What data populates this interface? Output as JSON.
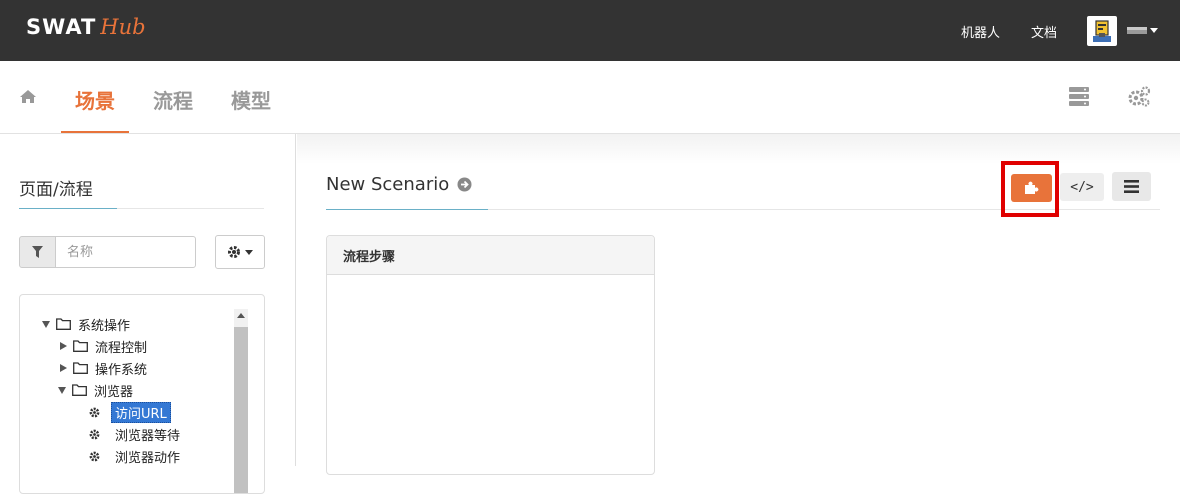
{
  "brand": {
    "part1": "SWAT",
    "part2": "Hub"
  },
  "topnav": {
    "robots": "机器人",
    "docs": "文档"
  },
  "nav": {
    "tabs": [
      {
        "label": "场景",
        "active": true
      },
      {
        "label": "流程",
        "active": false
      },
      {
        "label": "模型",
        "active": false
      }
    ]
  },
  "left": {
    "title": "页面/流程",
    "filter_placeholder": "名称",
    "tree": [
      {
        "label": "系统操作",
        "type": "folder",
        "expanded": true,
        "level": 0
      },
      {
        "label": "流程控制",
        "type": "folder",
        "expanded": false,
        "level": 1
      },
      {
        "label": "操作系统",
        "type": "folder",
        "expanded": false,
        "level": 1
      },
      {
        "label": "浏览器",
        "type": "folder",
        "expanded": true,
        "level": 1
      },
      {
        "label": "访问URL",
        "type": "leaf",
        "selected": true,
        "level": 2
      },
      {
        "label": "浏览器等待",
        "type": "leaf",
        "selected": false,
        "level": 2
      },
      {
        "label": "浏览器动作",
        "type": "leaf",
        "selected": false,
        "level": 2
      }
    ]
  },
  "main": {
    "scenario_title": "New Scenario",
    "code_button": "</>",
    "steps_panel_title": "流程步骤"
  },
  "colors": {
    "accent": "#e8733a",
    "topbar": "#333333",
    "highlight": "#e00000",
    "selection": "#3478d4"
  }
}
